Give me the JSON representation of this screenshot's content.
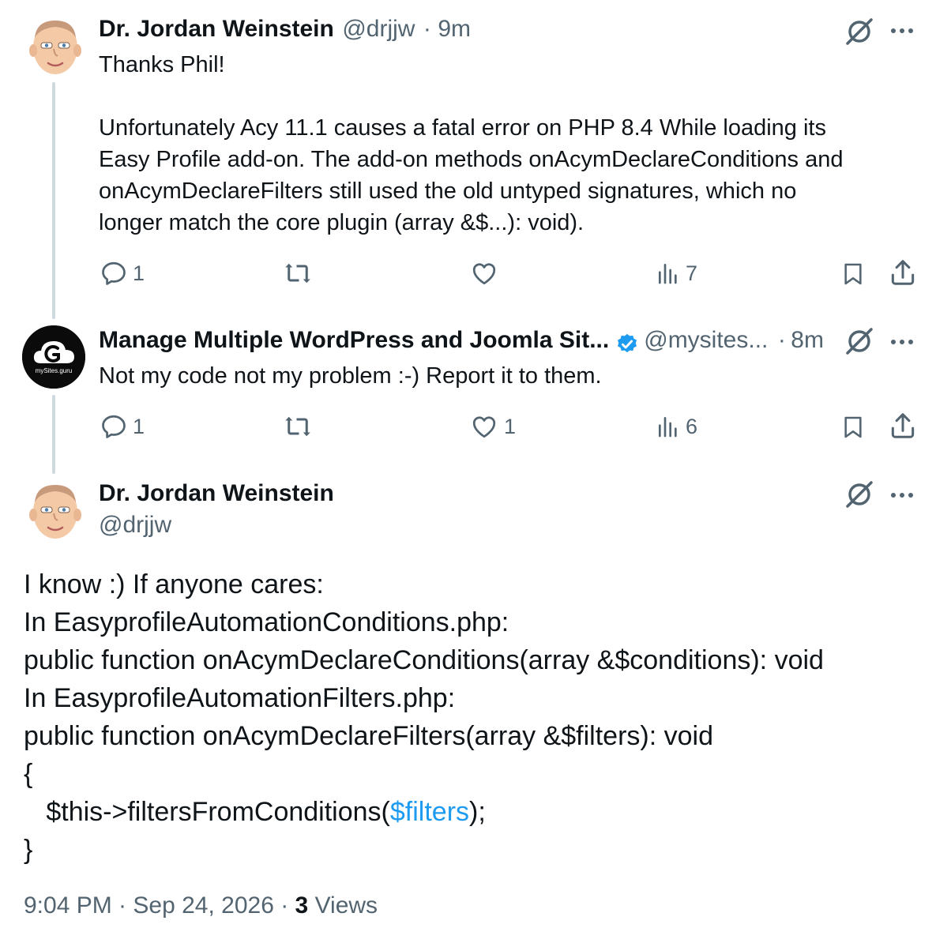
{
  "tweets": [
    {
      "author": "Dr. Jordan Weinstein",
      "handle": "@drjjw",
      "sep": "·",
      "time": "9m",
      "body": [
        "Thanks Phil!",
        "",
        "Unfortunately  Acy 11.1 causes a fatal error on PHP 8.4 While loading its",
        "Easy Profile add-on. The add-on methods onAcymDeclareConditions and",
        "onAcymDeclareFilters still used the old untyped signatures, which no",
        "longer match the core plugin (array &$...): void)."
      ],
      "actions": {
        "reply": "1",
        "repost": "",
        "like": "",
        "views": "7"
      }
    },
    {
      "author": "Manage Multiple WordPress and Joomla Sit...",
      "handle": "@mysites...",
      "sep": "·",
      "time": "8m",
      "avatar_text": "mySites.guru",
      "body": [
        "Not my code not my problem :-) Report it to them."
      ],
      "actions": {
        "reply": "1",
        "repost": "",
        "like": "1",
        "views": "6"
      }
    }
  ],
  "main_tweet": {
    "author": "Dr. Jordan Weinstein",
    "handle": "@drjjw",
    "lines": [
      "I know :) If anyone cares:",
      "In EasyprofileAutomationConditions.php:",
      "public function onAcymDeclareConditions(array &$conditions): void",
      "In EasyprofileAutomationFilters.php:",
      "public function onAcymDeclareFilters(array &$filters): void",
      "{"
    ],
    "code_prefix": "   $this->filtersFromConditions(",
    "code_link": "$filters",
    "code_suffix": ");",
    "closing": "}",
    "timestamp": "9:04 PM · Sep 24, 2026 · ",
    "views_count": "3",
    "views_label": " Views"
  },
  "icons": [
    "reply-icon",
    "repost-icon",
    "like-icon",
    "views-icon",
    "bookmark-icon",
    "share-icon",
    "grok-icon",
    "more-icon",
    "verified-badge-icon"
  ],
  "colors": {
    "text": "#0f1419",
    "secondary": "#536471",
    "link": "#1d9bf0",
    "thread_line": "#cfd9de"
  }
}
